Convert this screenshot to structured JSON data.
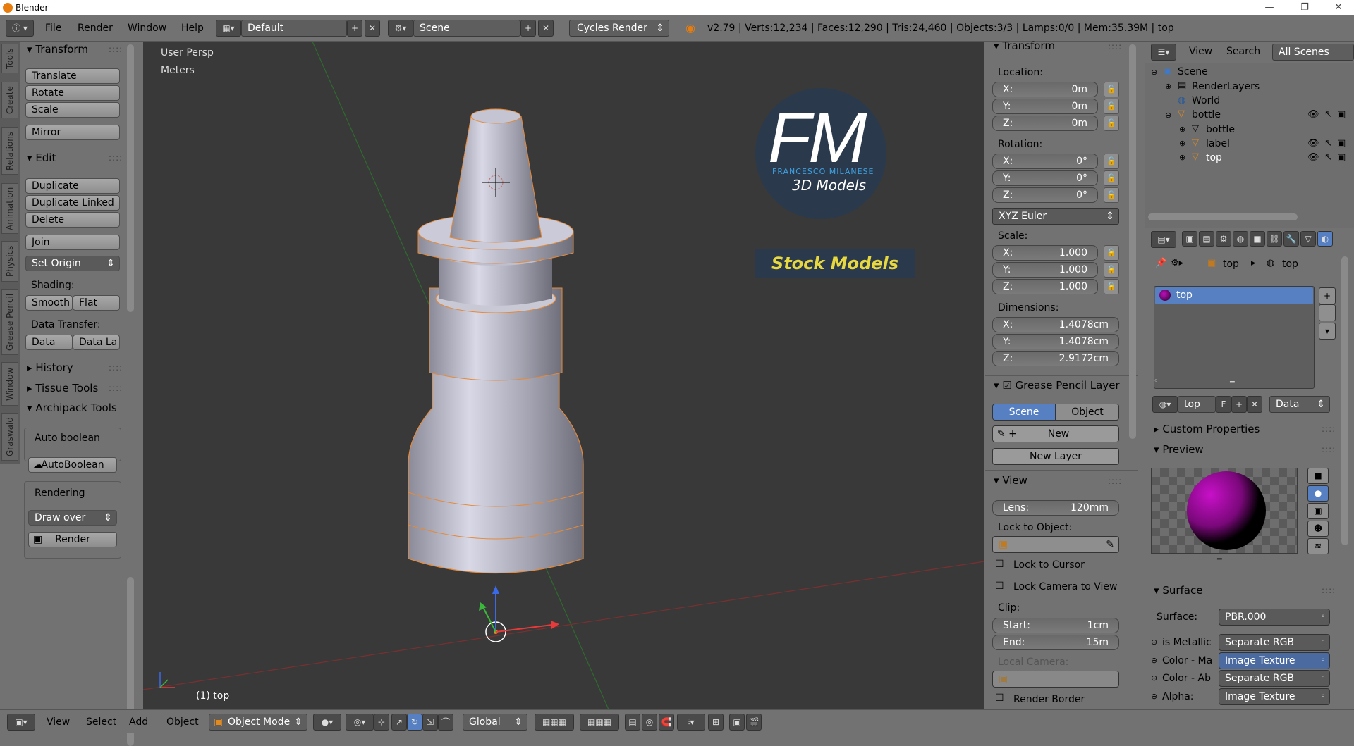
{
  "window": {
    "title": "Blender",
    "min": "—",
    "max": "❐",
    "close": "✕"
  },
  "topbar": {
    "menus": [
      "File",
      "Render",
      "Window",
      "Help"
    ],
    "layout": "Default",
    "scene": "Scene",
    "engine": "Cycles Render",
    "stats": "v2.79 | Verts:12,234 | Faces:12,290 | Tris:24,460 | Objects:3/3 | Lamps:0/0 | Mem:35.39M | top"
  },
  "tabs": [
    "Tools",
    "Create",
    "Relations",
    "Animation",
    "Physics",
    "Grease Pencil",
    "Window",
    "Graswald"
  ],
  "toolshelf": {
    "transform_title": "Transform",
    "translate": "Translate",
    "rotate": "Rotate",
    "scale": "Scale",
    "mirror": "Mirror",
    "edit_title": "Edit",
    "duplicate": "Duplicate",
    "duplicate_linked": "Duplicate Linked",
    "delete": "Delete",
    "join": "Join",
    "set_origin": "Set Origin",
    "shading_label": "Shading:",
    "smooth": "Smooth",
    "flat": "Flat",
    "data_transfer_label": "Data Transfer:",
    "data": "Data",
    "data_la": "Data La",
    "history": "History",
    "tissue": "Tissue Tools",
    "archipack": "Archipack Tools",
    "auto_boolean_label": "Auto boolean",
    "autoboolean": "AutoBoolean",
    "rendering_label": "Rendering",
    "draw_over": "Draw over",
    "render": "Render"
  },
  "viewport": {
    "view_name": "User Persp",
    "units": "Meters",
    "object_label": "(1) top",
    "watermark_letters": "FM",
    "watermark_name": "FRANCESCO MILANESE",
    "watermark_sub": "3D Models",
    "stock_models": "Stock Models"
  },
  "npanel": {
    "transform_title": "Transform",
    "location_label": "Location:",
    "loc": [
      {
        "k": "X:",
        "v": "0m"
      },
      {
        "k": "Y:",
        "v": "0m"
      },
      {
        "k": "Z:",
        "v": "0m"
      }
    ],
    "rotation_label": "Rotation:",
    "rot": [
      {
        "k": "X:",
        "v": "0°"
      },
      {
        "k": "Y:",
        "v": "0°"
      },
      {
        "k": "Z:",
        "v": "0°"
      }
    ],
    "rot_mode": "XYZ Euler",
    "scale_label": "Scale:",
    "scl": [
      {
        "k": "X:",
        "v": "1.000"
      },
      {
        "k": "Y:",
        "v": "1.000"
      },
      {
        "k": "Z:",
        "v": "1.000"
      }
    ],
    "dimensions_label": "Dimensions:",
    "dim": [
      {
        "k": "X:",
        "v": "1.4078cm"
      },
      {
        "k": "Y:",
        "v": "1.4078cm"
      },
      {
        "k": "Z:",
        "v": "2.9172cm"
      }
    ],
    "gp_title": "Grease Pencil Layer",
    "gp_scene": "Scene",
    "gp_object": "Object",
    "gp_new": "New",
    "gp_new_layer": "New Layer",
    "view_title": "View",
    "lens_k": "Lens:",
    "lens_v": "120mm",
    "lock_to_object": "Lock to Object:",
    "lock_cursor": "Lock to Cursor",
    "lock_camera": "Lock Camera to View",
    "clip_label": "Clip:",
    "start_k": "Start:",
    "start_v": "1cm",
    "end_k": "End:",
    "end_v": "15m",
    "local_camera": "Local Camera:",
    "render_border": "Render Border"
  },
  "outliner": {
    "view": "View",
    "search": "Search",
    "all_scenes": "All Scenes",
    "items": [
      "Scene",
      "RenderLayers",
      "World",
      "bottle",
      "bottle",
      "label",
      "top"
    ]
  },
  "properties": {
    "crumb1": "top",
    "crumb2": "top",
    "slot": "top",
    "mat_name": "top",
    "mat_f": "F",
    "data": "Data",
    "custom_props": "Custom Properties",
    "preview": "Preview",
    "surface_title": "Surface",
    "surface_k": "Surface:",
    "surface_v": "PBR.000",
    "inputs": [
      {
        "k": "is Metallic",
        "v": "Separate RGB"
      },
      {
        "k": "Color - Ma",
        "v": "Image Texture"
      },
      {
        "k": "Color - Ab",
        "v": "Separate RGB"
      },
      {
        "k": "Alpha:",
        "v": "Image Texture"
      }
    ]
  },
  "bottombar": {
    "menus": [
      "View",
      "Select",
      "Add",
      "Object"
    ],
    "mode": "Object Mode",
    "orientation": "Global"
  }
}
